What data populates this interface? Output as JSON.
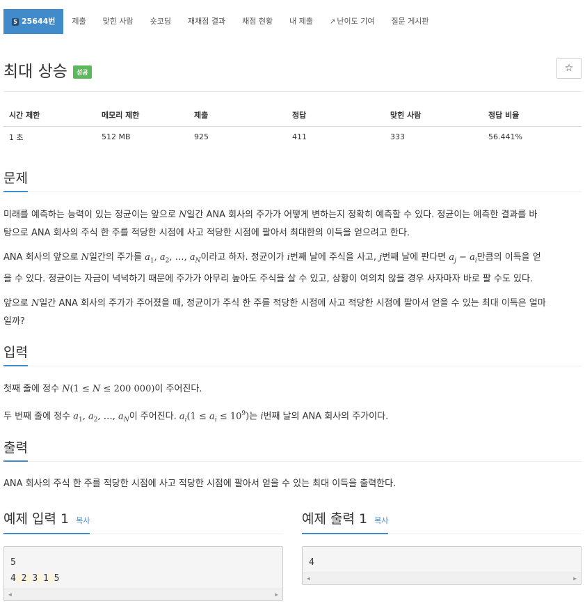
{
  "tabs": {
    "problem_number_badge": "5",
    "problem": "25644번",
    "submit": "제출",
    "solved_users": "맞힌 사람",
    "shortest": "숏코딩",
    "rejudge": "재채점 결과",
    "grading": "채점 현황",
    "my_submissions": "내 제출",
    "difficulty": "난이도 기여",
    "board": "질문 게시판"
  },
  "title": "최대 상승",
  "status_badge": "성공",
  "star_icon": "☆",
  "info_table": {
    "headers": [
      "시간 제한",
      "메모리 제한",
      "제출",
      "정답",
      "맞힌 사람",
      "정답 비율"
    ],
    "values": [
      "1 초",
      "512 MB",
      "925",
      "411",
      "333",
      "56.441%"
    ]
  },
  "sections": {
    "problem": "문제",
    "input": "입력",
    "output": "출력"
  },
  "problem_text": {
    "p1a": "미래를 예측하는 능력이 있는 정균이는 앞으로 ",
    "p1b": "일간 ANA 회사의 주가가 어떻게 변하는지 정확히 예측할 수 있다. 정균이는 예측한 결과를 바",
    "p1c": "탕으로 ANA 회사의 주식 한 주를 적당한 시점에 사고 적당한 시점에 팔아서 최대한의 이득을 얻으려고 한다.",
    "p2a": "ANA 회사의 앞으로 ",
    "p2b": "일간의 주가를 ",
    "p2c": "이라고 하자. 정균이가 ",
    "p2d": "번째 날에 주식을 사고, ",
    "p2e": "번째 날에 판다면 ",
    "p2f": "만큼의 이득을 얻",
    "p2g": "을 수 있다. 정균이는 자금이 넉넉하기 때문에 주가가 아무리 높아도 주식을 살 수 있고, 상황이 여의치 않을 경우 사자마자 바로 팔 수도 있다.",
    "p3a": "앞으로 ",
    "p3b": "일간 ANA 회사의 주가가 주어졌을 때, 정균이가 주식 한 주를 적당한 시점에 사고 적당한 시점에 팔아서 얻을 수 있는 최대 이득은 얼마",
    "p3c": "일까?"
  },
  "input_text": {
    "l1a": "첫째 줄에 정수 ",
    "l1b": "이 주어진다.",
    "l2a": "두 번째 줄에 정수 ",
    "l2b": "이 주어진다. ",
    "l2c": "는 ",
    "l2d": "번째 날의 ANA 회사의 주가이다."
  },
  "output_text": "ANA 회사의 주식 한 주를 적당한 시점에 사고 적당한 시점에 팔아서 얻을 수 있는 최대 이득을 출력한다.",
  "samples": {
    "input_title": "예제 입력 1",
    "output_title": "예제 출력 1",
    "copy_label": "복사",
    "input_line1": "5",
    "input_line2": [
      "4",
      "2",
      "3",
      "1",
      "5"
    ],
    "output_line1": "4"
  }
}
